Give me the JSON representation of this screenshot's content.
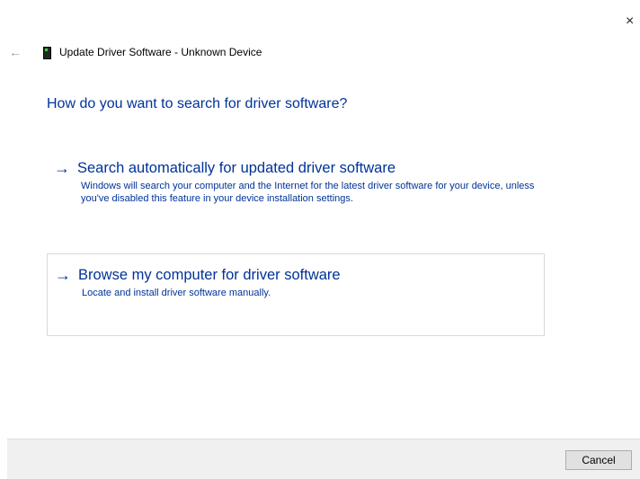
{
  "window": {
    "close_glyph": "×"
  },
  "header": {
    "back_glyph": "←",
    "title": "Update Driver Software - Unknown Device",
    "device_icon": "device-icon"
  },
  "question": "How do you want to search for driver software?",
  "options": [
    {
      "arrow": "→",
      "title": "Search automatically for updated driver software",
      "description": "Windows will search your computer and the Internet for the latest driver software for your device, unless you've disabled this feature in your device installation settings."
    },
    {
      "arrow": "→",
      "title": "Browse my computer for driver software",
      "description": "Locate and install driver software manually."
    }
  ],
  "footer": {
    "cancel_label": "Cancel"
  },
  "colors": {
    "accent": "#003399",
    "footer_bg": "#f0f0f0"
  }
}
